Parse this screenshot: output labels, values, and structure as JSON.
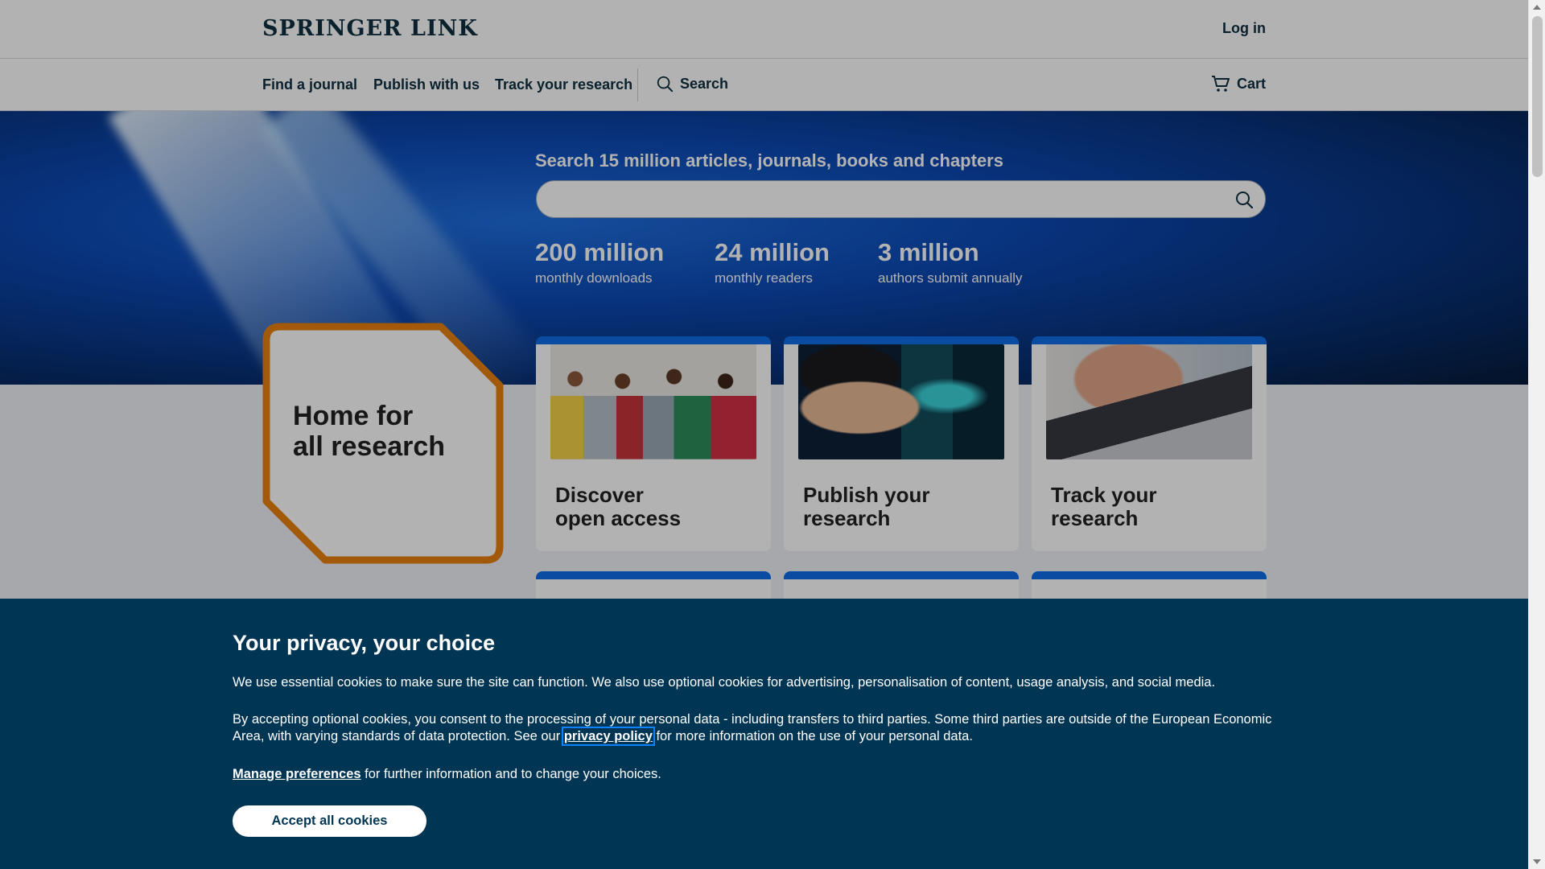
{
  "header": {
    "logo": "SPRINGER LINK",
    "login": "Log in"
  },
  "nav": {
    "items": [
      "Find a journal",
      "Publish with us",
      "Track your research"
    ],
    "search": "Search",
    "cart": "Cart"
  },
  "hero": {
    "title": "Search 15 million articles, journals, books and chapters",
    "search_value": "",
    "stats": [
      {
        "value": "200 million",
        "label": "monthly downloads"
      },
      {
        "value": "24 million",
        "label": "monthly readers"
      },
      {
        "value": "3 million",
        "label": "authors submit annually"
      }
    ]
  },
  "tagline": {
    "line1": "Home for",
    "line2": "all research"
  },
  "cards": [
    {
      "line1": "Discover",
      "line2": "open access"
    },
    {
      "line1": "Publish your",
      "line2": "research"
    },
    {
      "line1": "Track your",
      "line2": "research"
    }
  ],
  "cookie": {
    "heading": "Your privacy, your choice",
    "p1": "We use essential cookies to make sure the site can function. We also use optional cookies for advertising, personalisation of content, usage analysis, and social media.",
    "p2_before": "By accepting optional cookies, you consent to the processing of your personal data - including transfers to third parties. Some third parties are outside of the European Economic Area, with varying standards of data protection. See our ",
    "p2_link": "privacy policy",
    "p2_after": " for more information on the use of your personal data.",
    "p3_link": "Manage preferences",
    "p3_after": " for further information and to change your choices.",
    "accept": "Accept all cookies"
  },
  "colors": {
    "brand_dark": "#0f2f3f",
    "accent_blue": "#0d6ee8",
    "banner_bg": "#003553",
    "octagon_orange": "#e8800e"
  }
}
